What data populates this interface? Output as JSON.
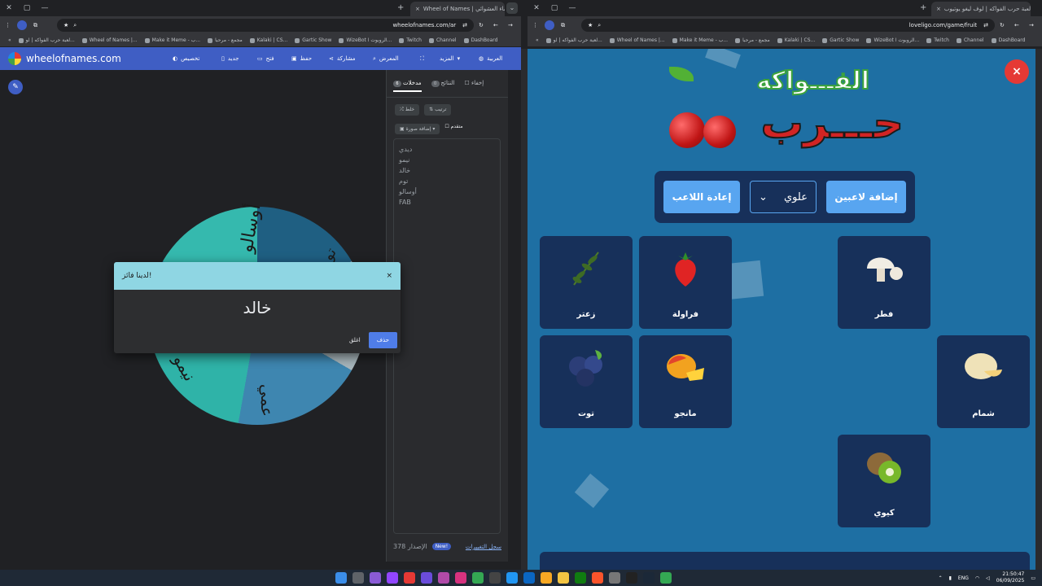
{
  "left_window": {
    "tab_title": "Wheel of Names | عجلة الأسماء العشوائي",
    "url": "wheelofnames.com/ar",
    "bookmarks": [
      "لعبة حرب الفواكه | لو...",
      "Wheel of Names |...",
      "Make it Meme - ب...",
      "مجمع - مرحبا",
      "Kalaki | CS...",
      "Gartic Show",
      "WizeBot الروبوت ا...",
      "Twitch",
      "Channel",
      "DashBoard"
    ],
    "site": {
      "title": "wheelofnames.com",
      "menu": [
        "تخصيص",
        "جديد",
        "فتح",
        "حفظ",
        "مشاركة",
        "المعرض",
        "",
        "المزيد",
        "العربية"
      ],
      "wheel_labels": [
        "أوسالو",
        "تو",
        "عمي",
        "نيمو",
        "ديدي"
      ],
      "sidebar": {
        "tab_entries": "مدخلات",
        "entries_count": "6",
        "tab_results": "النتائج",
        "results_count": "0",
        "hide": "إخفاء",
        "shuffle": "خلط",
        "sort": "ترتيب",
        "add_image": "إضافة صورة",
        "advanced": "متقدم",
        "names": [
          "ديدي",
          "نيمو",
          "خالد",
          "توم",
          "أوسالو",
          "FAB"
        ],
        "version_label": "الإصدار 378",
        "new_badge": "New!",
        "changelog": "سجل التغييرات"
      },
      "dialog": {
        "header": "لدينا فائز!",
        "winner": "خالد",
        "close": "×",
        "remove_button": "حذف",
        "close_button": "اغلق"
      }
    }
  },
  "right_window": {
    "tab_title": "لعبة حرب الفواكه | لوف ليغو يوتيوب",
    "url": "loveligo.com/game/fruit",
    "bookmarks": [
      "لعبة حرب الفواكه | لو...",
      "Wheel of Names |...",
      "Make it Meme - ب...",
      "مجمع - مرحبا",
      "Kalaki | CS...",
      "Gartic Show",
      "WizeBot الروبوت ا...",
      "Twitch",
      "Channel",
      "DashBoard"
    ],
    "game": {
      "logo_top": "الفـــواكه",
      "logo_main": "حـــرب",
      "close": "×",
      "add_players_button": "إضافة لاعبين",
      "selected_player": "علوي",
      "restart_button": "إعادة اللاعب",
      "cards": [
        "زعتر",
        "فراولة",
        "فطر",
        "توت",
        "مانجو",
        "شمام",
        "كيوي"
      ]
    }
  },
  "taskbar": {
    "language": "ENG",
    "time": "21:50:47",
    "date": "06/09/2025"
  },
  "colors": {
    "wheel_header": "#3f5ec4",
    "fruit_bg": "#1e6fa3",
    "card_bg": "#17305a",
    "accent_blue": "#58a5f0",
    "close_red": "#e53935",
    "dialog_header": "#8fd6e3"
  }
}
